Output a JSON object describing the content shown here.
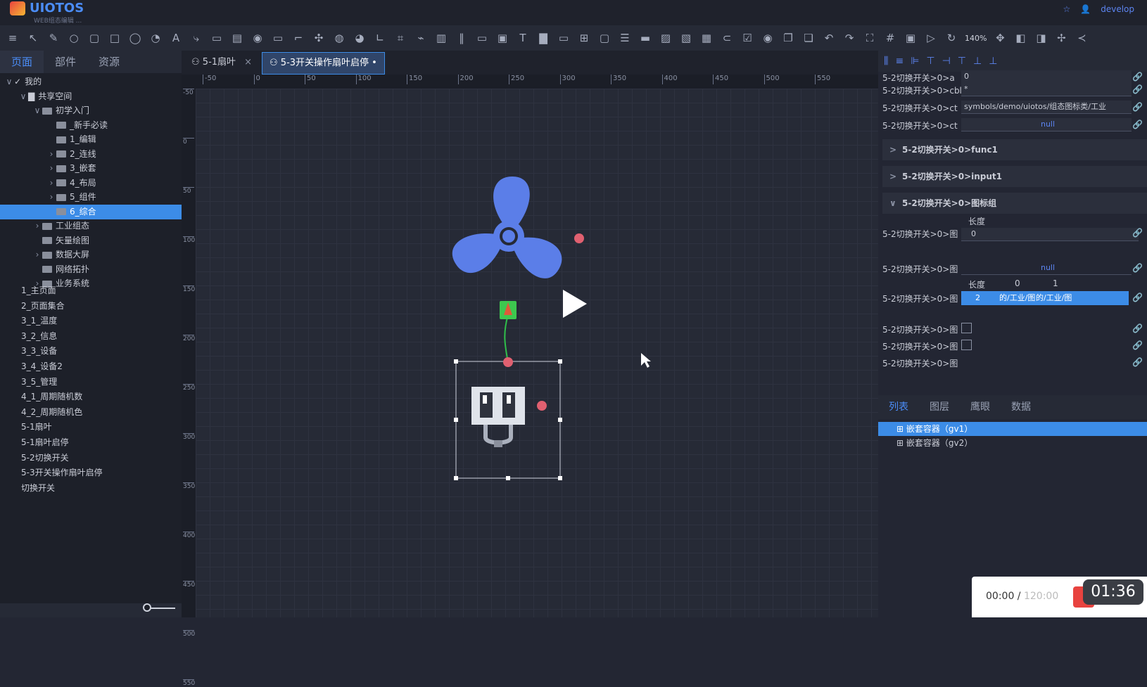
{
  "app": {
    "name": "UIOTOS",
    "subtitle": "WEB组态编辑 ...",
    "user": "develop"
  },
  "toolbar": {
    "zoom": "140%"
  },
  "left_panel": {
    "tabs": [
      "页面",
      "部件",
      "资源"
    ],
    "tree": [
      {
        "label": "我的",
        "level": 0,
        "arrow": "∨"
      },
      {
        "label": "共享空间",
        "level": 1,
        "arrow": "∨"
      },
      {
        "label": "初学入门",
        "level": 2,
        "arrow": "∨"
      },
      {
        "label": "_新手必读",
        "level": 3,
        "arrow": ""
      },
      {
        "label": "1_编辑",
        "level": 3,
        "arrow": ""
      },
      {
        "label": "2_连线",
        "level": 3,
        "arrow": "›"
      },
      {
        "label": "3_嵌套",
        "level": 3,
        "arrow": "›"
      },
      {
        "label": "4_布局",
        "level": 3,
        "arrow": "›"
      },
      {
        "label": "5_组件",
        "level": 3,
        "arrow": "›"
      },
      {
        "label": "6_综合",
        "level": 3,
        "arrow": "",
        "selected": true
      },
      {
        "label": "工业组态",
        "level": 2,
        "arrow": "›"
      },
      {
        "label": "矢量绘图",
        "level": 2,
        "arrow": ""
      },
      {
        "label": "数据大屏",
        "level": 2,
        "arrow": "›"
      },
      {
        "label": "网络拓扑",
        "level": 2,
        "arrow": ""
      },
      {
        "label": "业务系统",
        "level": 2,
        "arrow": "›"
      }
    ],
    "pages": [
      "1_主页面",
      "2_页面集合",
      "3_1_温度",
      "3_2_信息",
      "3_3_设备",
      "3_4_设备2",
      "3_5_管理",
      "4_1_周期随机数",
      "4_2_周期随机色",
      "5-1扇叶",
      "5-1扇叶启停",
      "5-2切换开关",
      "5-3开关操作扇叶启停",
      "切换开关"
    ]
  },
  "doc_tabs": [
    {
      "label": "5-1扇叶",
      "close": "×"
    },
    {
      "label": "5-3开关操作扇叶启停 •",
      "active": true
    }
  ],
  "ruler": {
    "h_labels": [
      "-50",
      "0",
      "50",
      "100",
      "150",
      "200",
      "250",
      "300",
      "350",
      "400",
      "450",
      "500",
      "550"
    ],
    "v_labels": [
      "-50",
      "0",
      "50",
      "100",
      "150",
      "200",
      "250",
      "300",
      "350",
      "400",
      "450",
      "500",
      "550"
    ]
  },
  "right_panel": {
    "props": [
      {
        "label": "5-2切换开关>0>a",
        "value": "0"
      },
      {
        "label": "5-2切换开关>0>cbl",
        "value": "*"
      },
      {
        "label": "5-2切换开关>0>ct",
        "value": "symbols/demo/uiotos/组态图标类/工业"
      },
      {
        "label": "5-2切换开关>0>ct",
        "value": "null"
      }
    ],
    "sections": [
      {
        "label": "5-2切换开关>0>func1",
        "chev": ">"
      },
      {
        "label": "5-2切换开关>0>input1",
        "chev": ">"
      },
      {
        "label": "5-2切换开关>0>图标组",
        "chev": "∨"
      }
    ],
    "group_rows": {
      "len_label": "长度",
      "row1_label": "5-2切换开关>0>图",
      "row1_value": "0",
      "row2_label": "5-2切换开关>0>图",
      "row2_value": "null",
      "row3_label": "5-2切换开关>0>图",
      "row3_headers": [
        "长度",
        "0",
        "1"
      ],
      "row3_values": [
        "2",
        "的/工业/图",
        "的/工业/图"
      ],
      "cb_labels": [
        "5-2切换开关>0>图",
        "5-2切换开关>0>图",
        "5-2切换开关>0>图"
      ]
    },
    "tabs": [
      "列表",
      "图层",
      "鹰眼",
      "数据"
    ],
    "layers": [
      {
        "label": "嵌套容器（gv1）",
        "selected": true
      },
      {
        "label": "嵌套容器（gv2）"
      }
    ]
  },
  "video": {
    "current": "00:00",
    "duration": "120:00",
    "timer": "01:36"
  },
  "colors": {
    "accent": "#3c8ce7",
    "fan": "#5b7ee8",
    "bg": "#232633"
  }
}
